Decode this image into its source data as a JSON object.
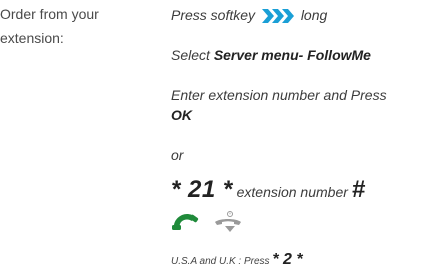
{
  "label": [
    "Order from your",
    "extension:"
  ],
  "steps": {
    "press_prefix": "Press softkey",
    "press_suffix": "long",
    "select_prefix": "Select",
    "select_bold": "Server menu- FollowMe",
    "enter_line1": "Enter extension number and Press",
    "enter_bold": "OK",
    "or_text": "or",
    "code_prefix": "* 21 *",
    "code_middle": "extension number",
    "code_suffix": "#",
    "us_prefix": "U.S.A and U.K : Press",
    "us_code": "* 2 *"
  },
  "icons": {
    "softkey": "forward-chevrons-icon",
    "offhook": "handset-offhook-icon",
    "onhook": "handset-onhook-icon"
  },
  "colors": {
    "softkey_blue": "#1a9fd6",
    "handset_green": "#1f8a3a",
    "handset_grey": "#9a9a9a"
  }
}
